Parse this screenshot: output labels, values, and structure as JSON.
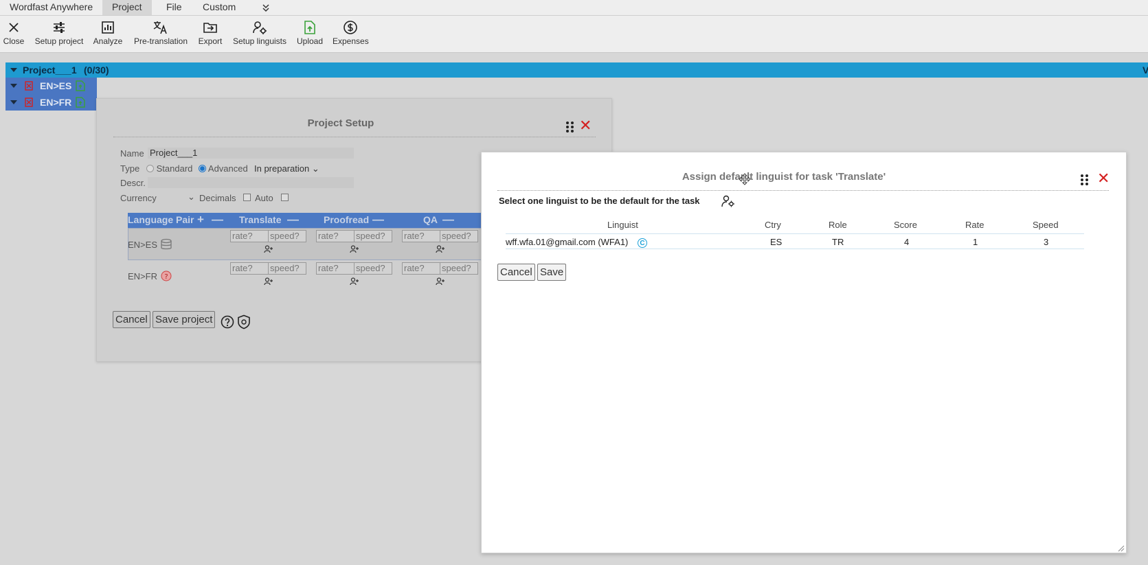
{
  "menu": {
    "items": [
      {
        "label": "Wordfast Anywhere"
      },
      {
        "label": "Project"
      },
      {
        "label": "File"
      },
      {
        "label": "Custom"
      }
    ],
    "more_icon": "chevron-double-down-icon"
  },
  "toolbar": {
    "close": "Close",
    "setup_project": "Setup project",
    "analyze": "Analyze",
    "pretranslation": "Pre-translation",
    "export": "Export",
    "setup_linguists": "Setup linguists",
    "upload": "Upload",
    "expenses": "Expenses"
  },
  "tree": {
    "project": "Project___1",
    "count": "(0/30)",
    "edge_letter": "V",
    "pairs": [
      {
        "label": "EN>ES"
      },
      {
        "label": "EN>FR"
      }
    ]
  },
  "project_setup": {
    "title": "Project Setup",
    "name_label": "Name",
    "name_value": "Project___1",
    "type_label": "Type",
    "type_standard": "Standard",
    "type_advanced": "Advanced",
    "status": "In preparation",
    "descr_label": "Descr.",
    "currency_label": "Currency",
    "decimals_label": "Decimals",
    "auto_label": "Auto",
    "table": {
      "col_pair": "Language Pair",
      "col_translate": "Translate",
      "col_proofread": "Proofread",
      "col_qa": "QA",
      "rate_placeholder": "rate?",
      "speed_placeholder": "speed?",
      "rows": [
        {
          "pair": "EN>ES"
        },
        {
          "pair": "EN>FR"
        }
      ]
    },
    "cancel": "Cancel",
    "save": "Save project"
  },
  "assign": {
    "title": "Assign default linguist for task 'Translate'",
    "subtitle": "Select one linguist to be the default for the task",
    "columns": {
      "linguist": "Linguist",
      "ctry": "Ctry",
      "role": "Role",
      "score": "Score",
      "rate": "Rate",
      "speed": "Speed"
    },
    "row": {
      "linguist": "wff.wfa.01@gmail.com (WFA1)",
      "badge": "C",
      "ctry": "ES",
      "role": "TR",
      "score": "4",
      "rate": "1",
      "speed": "3"
    },
    "cancel": "Cancel",
    "save": "Save"
  },
  "colors": {
    "tree_header": "#1e9ad0",
    "tree_row": "#4a76c2",
    "close_x": "#d42020",
    "upload_green": "#3aa23a",
    "badge_cyan": "#1aa0d8"
  }
}
